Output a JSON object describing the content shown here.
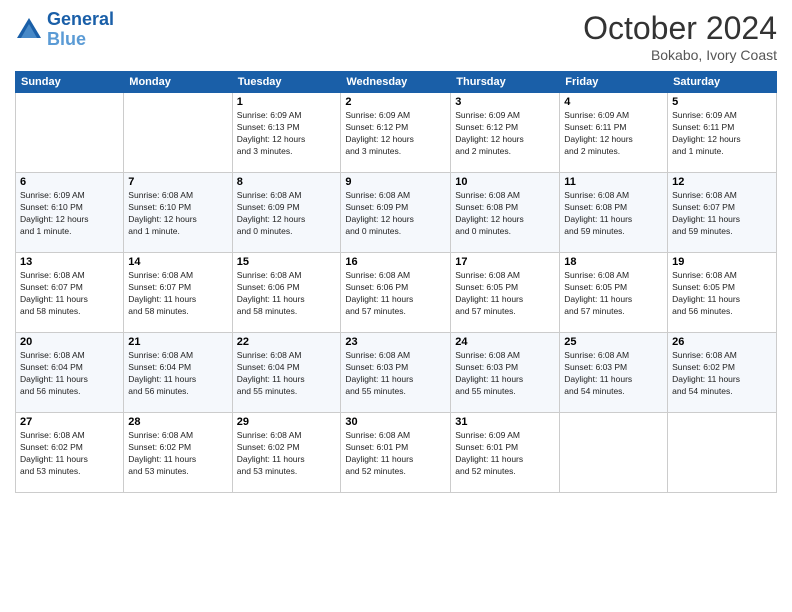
{
  "header": {
    "logo_line1": "General",
    "logo_line2": "Blue",
    "month": "October 2024",
    "location": "Bokabo, Ivory Coast"
  },
  "weekdays": [
    "Sunday",
    "Monday",
    "Tuesday",
    "Wednesday",
    "Thursday",
    "Friday",
    "Saturday"
  ],
  "weeks": [
    [
      {
        "day": "",
        "info": ""
      },
      {
        "day": "",
        "info": ""
      },
      {
        "day": "1",
        "info": "Sunrise: 6:09 AM\nSunset: 6:13 PM\nDaylight: 12 hours\nand 3 minutes."
      },
      {
        "day": "2",
        "info": "Sunrise: 6:09 AM\nSunset: 6:12 PM\nDaylight: 12 hours\nand 3 minutes."
      },
      {
        "day": "3",
        "info": "Sunrise: 6:09 AM\nSunset: 6:12 PM\nDaylight: 12 hours\nand 2 minutes."
      },
      {
        "day": "4",
        "info": "Sunrise: 6:09 AM\nSunset: 6:11 PM\nDaylight: 12 hours\nand 2 minutes."
      },
      {
        "day": "5",
        "info": "Sunrise: 6:09 AM\nSunset: 6:11 PM\nDaylight: 12 hours\nand 1 minute."
      }
    ],
    [
      {
        "day": "6",
        "info": "Sunrise: 6:09 AM\nSunset: 6:10 PM\nDaylight: 12 hours\nand 1 minute."
      },
      {
        "day": "7",
        "info": "Sunrise: 6:08 AM\nSunset: 6:10 PM\nDaylight: 12 hours\nand 1 minute."
      },
      {
        "day": "8",
        "info": "Sunrise: 6:08 AM\nSunset: 6:09 PM\nDaylight: 12 hours\nand 0 minutes."
      },
      {
        "day": "9",
        "info": "Sunrise: 6:08 AM\nSunset: 6:09 PM\nDaylight: 12 hours\nand 0 minutes."
      },
      {
        "day": "10",
        "info": "Sunrise: 6:08 AM\nSunset: 6:08 PM\nDaylight: 12 hours\nand 0 minutes."
      },
      {
        "day": "11",
        "info": "Sunrise: 6:08 AM\nSunset: 6:08 PM\nDaylight: 11 hours\nand 59 minutes."
      },
      {
        "day": "12",
        "info": "Sunrise: 6:08 AM\nSunset: 6:07 PM\nDaylight: 11 hours\nand 59 minutes."
      }
    ],
    [
      {
        "day": "13",
        "info": "Sunrise: 6:08 AM\nSunset: 6:07 PM\nDaylight: 11 hours\nand 58 minutes."
      },
      {
        "day": "14",
        "info": "Sunrise: 6:08 AM\nSunset: 6:07 PM\nDaylight: 11 hours\nand 58 minutes."
      },
      {
        "day": "15",
        "info": "Sunrise: 6:08 AM\nSunset: 6:06 PM\nDaylight: 11 hours\nand 58 minutes."
      },
      {
        "day": "16",
        "info": "Sunrise: 6:08 AM\nSunset: 6:06 PM\nDaylight: 11 hours\nand 57 minutes."
      },
      {
        "day": "17",
        "info": "Sunrise: 6:08 AM\nSunset: 6:05 PM\nDaylight: 11 hours\nand 57 minutes."
      },
      {
        "day": "18",
        "info": "Sunrise: 6:08 AM\nSunset: 6:05 PM\nDaylight: 11 hours\nand 57 minutes."
      },
      {
        "day": "19",
        "info": "Sunrise: 6:08 AM\nSunset: 6:05 PM\nDaylight: 11 hours\nand 56 minutes."
      }
    ],
    [
      {
        "day": "20",
        "info": "Sunrise: 6:08 AM\nSunset: 6:04 PM\nDaylight: 11 hours\nand 56 minutes."
      },
      {
        "day": "21",
        "info": "Sunrise: 6:08 AM\nSunset: 6:04 PM\nDaylight: 11 hours\nand 56 minutes."
      },
      {
        "day": "22",
        "info": "Sunrise: 6:08 AM\nSunset: 6:04 PM\nDaylight: 11 hours\nand 55 minutes."
      },
      {
        "day": "23",
        "info": "Sunrise: 6:08 AM\nSunset: 6:03 PM\nDaylight: 11 hours\nand 55 minutes."
      },
      {
        "day": "24",
        "info": "Sunrise: 6:08 AM\nSunset: 6:03 PM\nDaylight: 11 hours\nand 55 minutes."
      },
      {
        "day": "25",
        "info": "Sunrise: 6:08 AM\nSunset: 6:03 PM\nDaylight: 11 hours\nand 54 minutes."
      },
      {
        "day": "26",
        "info": "Sunrise: 6:08 AM\nSunset: 6:02 PM\nDaylight: 11 hours\nand 54 minutes."
      }
    ],
    [
      {
        "day": "27",
        "info": "Sunrise: 6:08 AM\nSunset: 6:02 PM\nDaylight: 11 hours\nand 53 minutes."
      },
      {
        "day": "28",
        "info": "Sunrise: 6:08 AM\nSunset: 6:02 PM\nDaylight: 11 hours\nand 53 minutes."
      },
      {
        "day": "29",
        "info": "Sunrise: 6:08 AM\nSunset: 6:02 PM\nDaylight: 11 hours\nand 53 minutes."
      },
      {
        "day": "30",
        "info": "Sunrise: 6:08 AM\nSunset: 6:01 PM\nDaylight: 11 hours\nand 52 minutes."
      },
      {
        "day": "31",
        "info": "Sunrise: 6:09 AM\nSunset: 6:01 PM\nDaylight: 11 hours\nand 52 minutes."
      },
      {
        "day": "",
        "info": ""
      },
      {
        "day": "",
        "info": ""
      }
    ]
  ]
}
